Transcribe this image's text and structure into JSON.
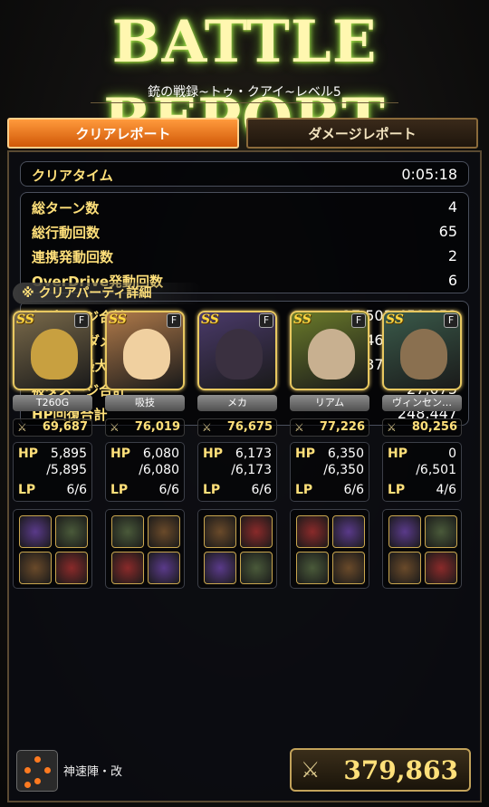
{
  "header": {
    "title": "BATTLE REPORT",
    "subtitle": "銃の戦録~トゥ・クアイ~レベル5"
  },
  "tabs": {
    "clear": "クリアレポート",
    "damage": "ダメージレポート"
  },
  "clear_time": {
    "label": "クリアタイム",
    "value": "0:05:18"
  },
  "turn_stats": [
    {
      "label": "総ターン数",
      "value": "4"
    },
    {
      "label": "総行動回数",
      "value": "65"
    },
    {
      "label": "連携発動回数",
      "value": "2"
    },
    {
      "label": "OverDrive発動回数",
      "value": "6"
    }
  ],
  "damage_stats": [
    {
      "label": "与ダメージ合計",
      "value": "27,503,459,253"
    },
    {
      "label": "一撃最大ダメージ",
      "value": "469,555,868"
    },
    {
      "label": "1ターン最大ダメージ",
      "value": "10,372,440,241"
    },
    {
      "label": "被ダメージ合計",
      "value": "27,075"
    },
    {
      "label": "HP回復合計",
      "value": "248,447"
    }
  ],
  "party_header": "※ クリアパーティ詳細",
  "party": [
    {
      "rarity": "SS",
      "type_tag": "F",
      "name": "T260G",
      "power": "69,687",
      "hp_label": "HP",
      "hp": "5,895",
      "hp_max": "/5,895",
      "lp_label": "LP",
      "lp": "6/6",
      "color": "#7a6a4a",
      "face_color": "#c8a040"
    },
    {
      "rarity": "SS",
      "type_tag": "F",
      "name": "吸技",
      "power": "76,019",
      "hp_label": "HP",
      "hp": "6,080",
      "hp_max": "/6,080",
      "lp_label": "LP",
      "lp": "6/6",
      "color": "#b07a4a",
      "face_color": "#f0d0a0"
    },
    {
      "rarity": "SS",
      "type_tag": "F",
      "name": "メカ",
      "power": "76,675",
      "hp_label": "HP",
      "hp": "6,173",
      "hp_max": "/6,173",
      "lp_label": "LP",
      "lp": "6/6",
      "color": "#4a3a6a",
      "face_color": "#3a3040"
    },
    {
      "rarity": "SS",
      "type_tag": "F",
      "name": "リアム",
      "power": "77,226",
      "hp_label": "HP",
      "hp": "6,350",
      "hp_max": "/6,350",
      "lp_label": "LP",
      "lp": "6/6",
      "color": "#6a7a2a",
      "face_color": "#c8b090"
    },
    {
      "rarity": "SS",
      "type_tag": "F",
      "name": "ヴィンセン…",
      "power": "80,256",
      "hp_label": "HP",
      "hp": "0",
      "hp_max": "/6,501",
      "lp_label": "LP",
      "lp": "4/6",
      "color": "#3a5a4a",
      "face_color": "#8a7050"
    }
  ],
  "formation": "神速陣・改",
  "total_power": "379,863",
  "colors": {
    "accent": "#ffe07a",
    "tab_active": "#d05808",
    "border": "#5a4a32"
  }
}
